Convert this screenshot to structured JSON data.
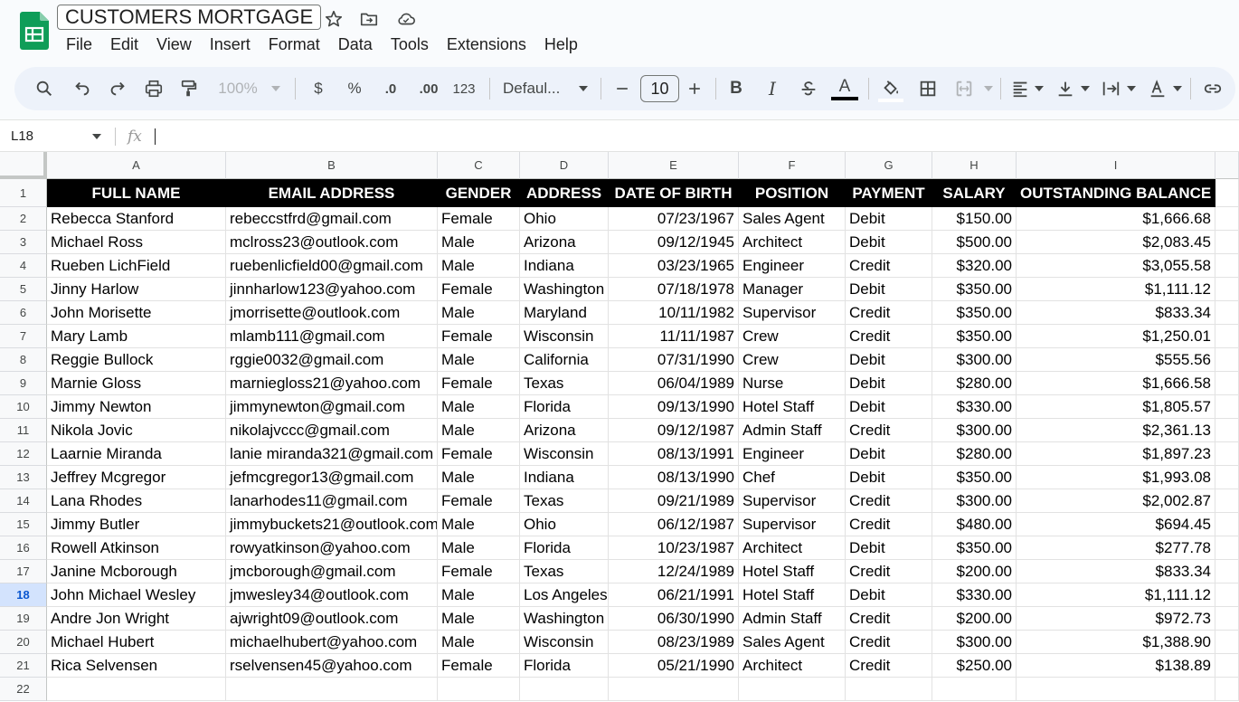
{
  "doc": {
    "title": "CUSTOMERS MORTGAGE"
  },
  "menu": [
    "File",
    "Edit",
    "View",
    "Insert",
    "Format",
    "Data",
    "Tools",
    "Extensions",
    "Help"
  ],
  "toolbar": {
    "zoom": "100%",
    "currency": "$",
    "percent": "%",
    "decrease_decimal": ".0",
    "increase_decimal": ".00",
    "more_formats": "123",
    "font": "Defaul...",
    "font_size": "10",
    "bold": "B",
    "italic": "I",
    "text_color": "A"
  },
  "formula_bar": {
    "name_box": "L18",
    "fx": "fx",
    "formula": ""
  },
  "columns": [
    "A",
    "B",
    "C",
    "D",
    "E",
    "F",
    "G",
    "H",
    "I"
  ],
  "row_numbers": [
    "1",
    "2",
    "3",
    "4",
    "5",
    "6",
    "7",
    "8",
    "9",
    "10",
    "11",
    "12",
    "13",
    "14",
    "15",
    "16",
    "17",
    "18",
    "19",
    "20",
    "21",
    "22"
  ],
  "active_row": "18",
  "headers": [
    "FULL NAME",
    "EMAIL ADDRESS",
    "GENDER",
    "ADDRESS",
    "DATE OF BIRTH",
    "POSITION",
    "PAYMENT",
    "SALARY",
    "OUTSTANDING BALANCE"
  ],
  "rows": [
    [
      "Rebecca Stanford",
      "rebeccstfrd@gmail.com",
      "Female",
      "Ohio",
      "07/23/1967",
      "Sales Agent",
      "Debit",
      "$150.00",
      "$1,666.68"
    ],
    [
      "Michael Ross",
      "mclross23@outlook.com",
      "Male",
      "Arizona",
      "09/12/1945",
      "Architect",
      "Debit",
      "$500.00",
      "$2,083.45"
    ],
    [
      "Rueben LichField",
      "ruebenlicfield00@gmail.com",
      "Male",
      "Indiana",
      "03/23/1965",
      "Engineer",
      "Credit",
      "$320.00",
      "$3,055.58"
    ],
    [
      "Jinny Harlow",
      "jinnharlow123@yahoo.com",
      "Female",
      "Washington",
      "07/18/1978",
      "Manager",
      "Debit",
      "$350.00",
      "$1,111.12"
    ],
    [
      "John Morisette",
      "jmorrisette@outlook.com",
      "Male",
      "Maryland",
      "10/11/1982",
      "Supervisor",
      "Credit",
      "$350.00",
      "$833.34"
    ],
    [
      "Mary Lamb",
      "mlamb111@gmail.com",
      "Female",
      "Wisconsin",
      "11/11/1987",
      "Crew",
      "Credit",
      "$350.00",
      "$1,250.01"
    ],
    [
      "Reggie Bullock",
      "rggie0032@gmail.com",
      "Male",
      "California",
      "07/31/1990",
      "Crew",
      "Debit",
      "$300.00",
      "$555.56"
    ],
    [
      "Marnie Gloss",
      "marniegloss21@yahoo.com",
      "Female",
      "Texas",
      "06/04/1989",
      "Nurse",
      "Debit",
      "$280.00",
      "$1,666.58"
    ],
    [
      "Jimmy Newton",
      "jimmynewton@gmail.com",
      "Male",
      "Florida",
      "09/13/1990",
      "Hotel Staff",
      "Debit",
      "$330.00",
      "$1,805.57"
    ],
    [
      "Nikola Jovic",
      "nikolajvccc@gmail.com",
      "Male",
      "Arizona",
      "09/12/1987",
      "Admin Staff",
      "Credit",
      "$300.00",
      "$2,361.13"
    ],
    [
      "Laarnie Miranda",
      "lanie miranda321@gmail.com",
      "Female",
      "Wisconsin",
      "08/13/1991",
      "Engineer",
      "Debit",
      "$280.00",
      "$1,897.23"
    ],
    [
      "Jeffrey Mcgregor",
      "jefmcgregor13@gmail.com",
      "Male",
      "Indiana",
      "08/13/1990",
      "Chef",
      "Debit",
      "$350.00",
      "$1,993.08"
    ],
    [
      "Lana Rhodes",
      "lanarhodes11@gmail.com",
      "Female",
      "Texas",
      "09/21/1989",
      "Supervisor",
      "Credit",
      "$300.00",
      "$2,002.87"
    ],
    [
      "Jimmy Butler",
      "jimmybuckets21@outlook.com",
      "Male",
      "Ohio",
      "06/12/1987",
      "Supervisor",
      "Credit",
      "$480.00",
      "$694.45"
    ],
    [
      "Rowell Atkinson",
      "rowyatkinson@yahoo.com",
      "Male",
      "Florida",
      "10/23/1987",
      "Architect",
      "Debit",
      "$350.00",
      "$277.78"
    ],
    [
      "Janine Mcborough",
      "jmcborough@gmail.com",
      "Female",
      "Texas",
      "12/24/1989",
      "Hotel Staff",
      "Credit",
      "$200.00",
      "$833.34"
    ],
    [
      "John Michael Wesley",
      "jmwesley34@outlook.com",
      "Male",
      "Los Angeles",
      "06/21/1991",
      "Hotel Staff",
      "Debit",
      "$330.00",
      "$1,111.12"
    ],
    [
      "Andre Jon Wright",
      "ajwright09@outlook.com",
      "Male",
      "Washington",
      "06/30/1990",
      "Admin Staff",
      "Credit",
      "$200.00",
      "$972.73"
    ],
    [
      "Michael Hubert",
      "michaelhubert@yahoo.com",
      "Male",
      "Wisconsin",
      "08/23/1989",
      "Sales Agent",
      "Credit",
      "$300.00",
      "$1,388.90"
    ],
    [
      "Rica Selvensen",
      "rselvensen45@yahoo.com",
      "Female",
      "Florida",
      "05/21/1990",
      "Architect",
      "Credit",
      "$250.00",
      "$138.89"
    ]
  ]
}
